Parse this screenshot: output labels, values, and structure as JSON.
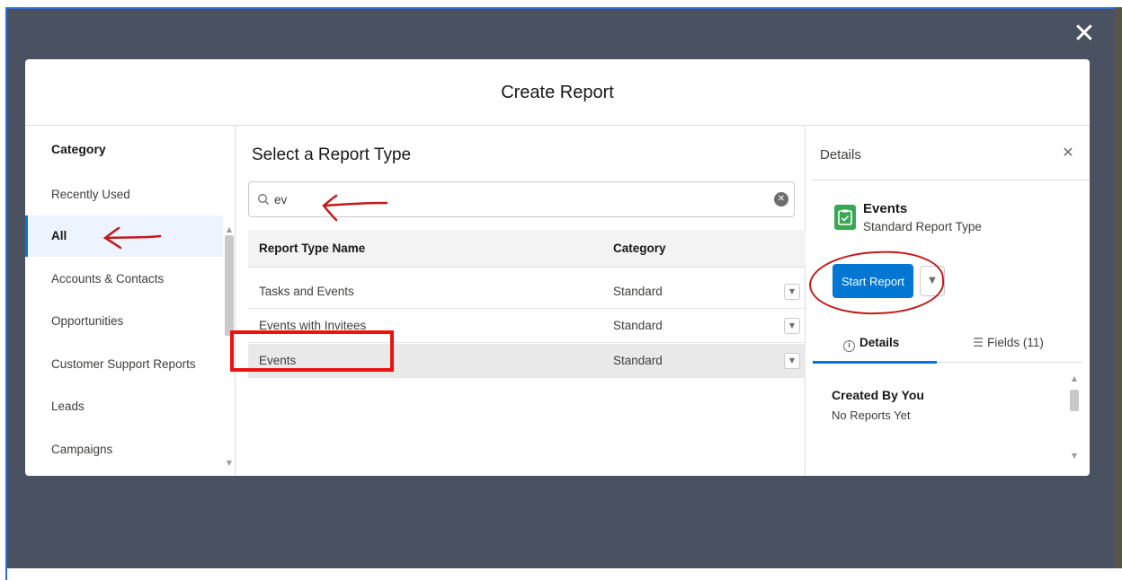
{
  "modal": {
    "title": "Create Report"
  },
  "category": {
    "heading": "Category",
    "items": [
      {
        "label": "Recently Used"
      },
      {
        "label": "All"
      },
      {
        "label": "Accounts & Contacts"
      },
      {
        "label": "Opportunities"
      },
      {
        "label": "Customer Support Reports"
      },
      {
        "label": "Leads"
      },
      {
        "label": "Campaigns"
      }
    ],
    "selected": "All"
  },
  "report_types": {
    "heading": "Select a Report Type",
    "search": {
      "value": "ev",
      "placeholder": ""
    },
    "columns": {
      "name": "Report Type Name",
      "category": "Category"
    },
    "rows": [
      {
        "name": "Tasks and Events",
        "category": "Standard"
      },
      {
        "name": "Events with Invitees",
        "category": "Standard"
      },
      {
        "name": "Events",
        "category": "Standard"
      }
    ],
    "selected_row": "Events"
  },
  "details": {
    "heading": "Details",
    "type_title": "Events",
    "type_subtitle": "Standard Report Type",
    "start_button": "Start Report",
    "tabs": [
      {
        "label": "Details"
      },
      {
        "label": "Fields (11)"
      }
    ],
    "created_title": "Created By You",
    "created_sub": "No Reports Yet"
  },
  "colors": {
    "overlay": "#4a5262",
    "brand_blue": "#0176d3",
    "annotation_red": "#ee1111",
    "icon_green": "#3ba755"
  },
  "icons": [
    "close-icon",
    "search-icon",
    "clear-search-icon",
    "chevron-down-icon",
    "report-type-icon",
    "info-icon",
    "list-icon"
  ]
}
